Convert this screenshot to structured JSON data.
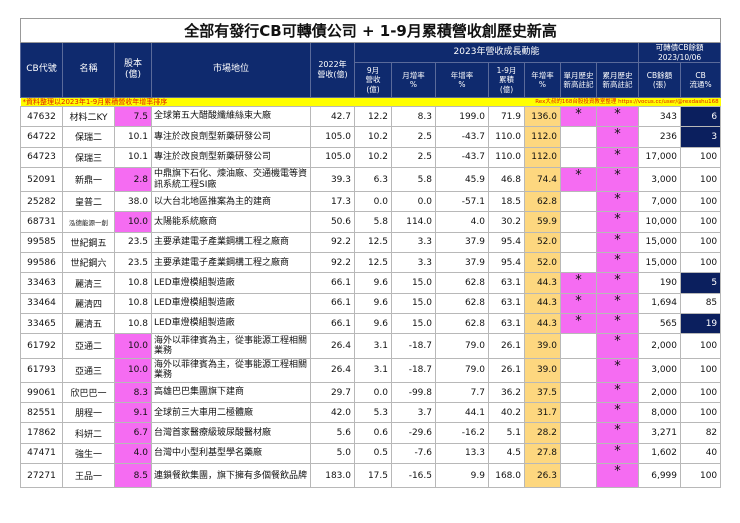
{
  "title": "全部有發行CB可轉債公司 + 1-9月累積營收創歷史新高",
  "headers": {
    "cb_code": "CB代號",
    "name": "名稱",
    "capital": "股本\n(億)",
    "market": "市場地位",
    "rev2022": "2022年\n營收(億)",
    "growth_group": "2023年營收成長動能",
    "cb_group": "可轉債CB餘額\n2023/10/06",
    "sep_rev": "9月\n營收\n(億)",
    "mom": "月增率\n%",
    "yoy": "年增率\n%",
    "cum_rev": "1-9月\n累積\n(億)",
    "cum_yoy": "年增率\n%",
    "single_high": "單月歷史\n新高註記",
    "cum_high": "累月歷史\n新高註記",
    "cb_balance": "CB餘額\n(張)",
    "cb_float": "CB\n流通%"
  },
  "note_left": "*資料整理以2023年1-9月累積營收年增率排序",
  "note_right": "Rex大叔的168台股投資教室整理 https://vocus.cc/user/@rexdashu168",
  "colors": {
    "header": "#0f2a6e",
    "highlight": "#f56cf2",
    "cum_yoy": "#fdd77f",
    "note": "#ffff00",
    "low_float": "#0b1f5e"
  },
  "rows": [
    {
      "code": "47632",
      "name": "材料二KY",
      "capital": "7.5",
      "cap_hl": true,
      "market": "全球第五大醋酸纖維絲束大廠",
      "rev2022": "42.7",
      "sep": "12.2",
      "mom": "8.3",
      "yoy": "199.0",
      "cum": "71.9",
      "cum_yoy": "136.0",
      "single": "*",
      "cumh": "*",
      "bal": "343",
      "flt": "6",
      "flt_hl": true
    },
    {
      "code": "64722",
      "name": "保瑞二",
      "capital": "10.1",
      "cap_hl": false,
      "market": "專注於改良劑型新藥研發公司",
      "rev2022": "105.0",
      "sep": "10.2",
      "mom": "2.5",
      "yoy": "-43.7",
      "cum": "110.0",
      "cum_yoy": "112.0",
      "single": "",
      "cumh": "*",
      "bal": "236",
      "flt": "3",
      "flt_hl": true
    },
    {
      "code": "64723",
      "name": "保瑞三",
      "capital": "10.1",
      "cap_hl": false,
      "market": "專注於改良劑型新藥研發公司",
      "rev2022": "105.0",
      "sep": "10.2",
      "mom": "2.5",
      "yoy": "-43.7",
      "cum": "110.0",
      "cum_yoy": "112.0",
      "single": "",
      "cumh": "*",
      "bal": "17,000",
      "flt": "100",
      "flt_hl": false
    },
    {
      "code": "52091",
      "name": "新鼎一",
      "capital": "2.8",
      "cap_hl": true,
      "market": "中鼎旗下石化、煉油廠、交通機電等資訊系統工程SI廠",
      "tall": true,
      "rev2022": "39.3",
      "sep": "6.3",
      "mom": "5.8",
      "yoy": "45.9",
      "cum": "46.8",
      "cum_yoy": "74.4",
      "single": "*",
      "cumh": "*",
      "bal": "3,000",
      "flt": "100",
      "flt_hl": false
    },
    {
      "code": "25282",
      "name": "皇普二",
      "capital": "38.0",
      "cap_hl": false,
      "market": "以大台北地區推案為主的建商",
      "rev2022": "17.3",
      "sep": "0.0",
      "mom": "0.0",
      "yoy": "-57.1",
      "cum": "18.5",
      "cum_yoy": "62.8",
      "single": "",
      "cumh": "*",
      "bal": "7,000",
      "flt": "100",
      "flt_hl": false
    },
    {
      "code": "68731",
      "name": "泓德能源一創",
      "small": true,
      "capital": "10.0",
      "cap_hl": true,
      "market": "太陽能系統廠商",
      "rev2022": "50.6",
      "sep": "5.8",
      "mom": "114.0",
      "yoy": "4.0",
      "cum": "30.2",
      "cum_yoy": "59.9",
      "single": "",
      "cumh": "*",
      "bal": "10,000",
      "flt": "100",
      "flt_hl": false
    },
    {
      "code": "99585",
      "name": "世紀鋼五",
      "capital": "23.5",
      "cap_hl": false,
      "market": "主要承建電子產業鋼構工程之廠商",
      "rev2022": "92.2",
      "sep": "12.5",
      "mom": "3.3",
      "yoy": "37.9",
      "cum": "95.4",
      "cum_yoy": "52.0",
      "single": "",
      "cumh": "*",
      "bal": "15,000",
      "flt": "100",
      "flt_hl": false
    },
    {
      "code": "99586",
      "name": "世紀鋼六",
      "capital": "23.5",
      "cap_hl": false,
      "market": "主要承建電子產業鋼構工程之廠商",
      "rev2022": "92.2",
      "sep": "12.5",
      "mom": "3.3",
      "yoy": "37.9",
      "cum": "95.4",
      "cum_yoy": "52.0",
      "single": "",
      "cumh": "*",
      "bal": "15,000",
      "flt": "100",
      "flt_hl": false
    },
    {
      "code": "33463",
      "name": "麗清三",
      "capital": "10.8",
      "cap_hl": false,
      "market": "LED車燈模組製造廠",
      "rev2022": "66.1",
      "sep": "9.6",
      "mom": "15.0",
      "yoy": "62.8",
      "cum": "63.1",
      "cum_yoy": "44.3",
      "single": "*",
      "cumh": "*",
      "bal": "190",
      "flt": "5",
      "flt_hl": true
    },
    {
      "code": "33464",
      "name": "麗清四",
      "capital": "10.8",
      "cap_hl": false,
      "market": "LED車燈模組製造廠",
      "rev2022": "66.1",
      "sep": "9.6",
      "mom": "15.0",
      "yoy": "62.8",
      "cum": "63.1",
      "cum_yoy": "44.3",
      "single": "*",
      "cumh": "*",
      "bal": "1,694",
      "flt": "85",
      "flt_hl": false
    },
    {
      "code": "33465",
      "name": "麗清五",
      "capital": "10.8",
      "cap_hl": false,
      "market": "LED車燈模組製造廠",
      "rev2022": "66.1",
      "sep": "9.6",
      "mom": "15.0",
      "yoy": "62.8",
      "cum": "63.1",
      "cum_yoy": "44.3",
      "single": "*",
      "cumh": "*",
      "bal": "565",
      "flt": "19",
      "flt_hl": true
    },
    {
      "code": "61792",
      "name": "亞通二",
      "capital": "10.0",
      "cap_hl": true,
      "market": "海外以菲律賓為主，從事能源工程相關業務",
      "tall": true,
      "rev2022": "26.4",
      "sep": "3.1",
      "mom": "-18.7",
      "yoy": "79.0",
      "cum": "26.1",
      "cum_yoy": "39.0",
      "single": "",
      "cumh": "*",
      "bal": "2,000",
      "flt": "100",
      "flt_hl": false
    },
    {
      "code": "61793",
      "name": "亞通三",
      "capital": "10.0",
      "cap_hl": true,
      "market": "海外以菲律賓為主，從事能源工程相關業務",
      "tall": true,
      "rev2022": "26.4",
      "sep": "3.1",
      "mom": "-18.7",
      "yoy": "79.0",
      "cum": "26.1",
      "cum_yoy": "39.0",
      "single": "",
      "cumh": "*",
      "bal": "3,000",
      "flt": "100",
      "flt_hl": false
    },
    {
      "code": "99061",
      "name": "欣巴巴一",
      "capital": "8.3",
      "cap_hl": true,
      "market": "高雄巴巴集團旗下建商",
      "rev2022": "29.7",
      "sep": "0.0",
      "mom": "-99.8",
      "yoy": "7.7",
      "cum": "36.2",
      "cum_yoy": "37.5",
      "single": "",
      "cumh": "*",
      "bal": "2,000",
      "flt": "100",
      "flt_hl": false
    },
    {
      "code": "82551",
      "name": "朋程一",
      "capital": "9.1",
      "cap_hl": true,
      "market": "全球前三大車用二極體廠",
      "rev2022": "42.0",
      "sep": "5.3",
      "mom": "3.7",
      "yoy": "44.1",
      "cum": "40.2",
      "cum_yoy": "31.7",
      "single": "",
      "cumh": "*",
      "bal": "8,000",
      "flt": "100",
      "flt_hl": false
    },
    {
      "code": "17862",
      "name": "科妍二",
      "capital": "6.7",
      "cap_hl": true,
      "market": "台灣首家醫療級玻尿酸醫材廠",
      "rev2022": "5.6",
      "sep": "0.6",
      "mom": "-29.6",
      "yoy": "-16.2",
      "cum": "5.1",
      "cum_yoy": "28.2",
      "single": "",
      "cumh": "*",
      "bal": "3,271",
      "flt": "82",
      "flt_hl": false
    },
    {
      "code": "47471",
      "name": "強生一",
      "capital": "4.0",
      "cap_hl": true,
      "market": "台灣中小型利基型學名藥廠",
      "rev2022": "5.0",
      "sep": "0.5",
      "mom": "-7.6",
      "yoy": "13.3",
      "cum": "4.5",
      "cum_yoy": "27.8",
      "single": "",
      "cumh": "*",
      "bal": "1,602",
      "flt": "40",
      "flt_hl": false
    },
    {
      "code": "27271",
      "name": "王品一",
      "capital": "8.5",
      "cap_hl": true,
      "market": "連鎖餐飲集團，旗下擁有多個餐飲品牌",
      "tall": true,
      "rev2022": "183.0",
      "sep": "17.5",
      "mom": "-16.5",
      "yoy": "9.9",
      "cum": "168.0",
      "cum_yoy": "26.3",
      "single": "",
      "cumh": "*",
      "bal": "6,999",
      "flt": "100",
      "flt_hl": false
    }
  ]
}
